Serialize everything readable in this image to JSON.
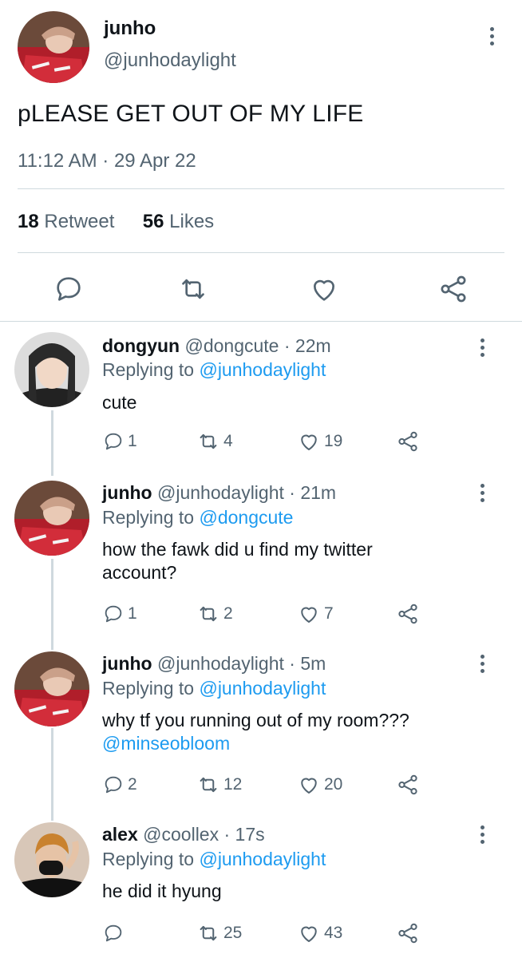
{
  "main_tweet": {
    "name": "junho",
    "handle": "@junhodaylight",
    "text": "pLEASE GET OUT OF MY LIFE",
    "timestamp": "11:12 AM · 29 Apr 22",
    "retweets_count": "18",
    "retweets_label": "Retweet",
    "likes_count": "56",
    "likes_label": "Likes",
    "actions": [
      "reply-icon",
      "retweet-icon",
      "like-icon",
      "share-icon"
    ]
  },
  "replies": [
    {
      "name": "dongyun",
      "handle": "@dongcute",
      "time": "· 22m",
      "replying_prefix": "Replying to",
      "replying_to": "@junhodaylight",
      "text": "cute",
      "mention": "",
      "reply_count": "1",
      "retweet_count": "4",
      "like_count": "19"
    },
    {
      "name": "junho",
      "handle": "@junhodaylight",
      "time": "· 21m",
      "replying_prefix": "Replying to",
      "replying_to": "@dongcute",
      "text_line1": "how the fawk did u find my twitter",
      "text_line2": "account?",
      "reply_count": "1",
      "retweet_count": "2",
      "like_count": "7"
    },
    {
      "name": "junho",
      "handle": "@junhodaylight",
      "time": "· 5m",
      "replying_prefix": "Replying to",
      "replying_to": "@junhodaylight",
      "text": "why tf you running out of my room???",
      "mention": "@minseobloom",
      "reply_count": "2",
      "retweet_count": "12",
      "like_count": "20"
    },
    {
      "name": "alex",
      "handle": "@coollex",
      "time": "· 17s",
      "replying_prefix": "Replying to",
      "replying_to": "@junhodaylight",
      "text": "he did it hyung",
      "reply_count": "",
      "retweet_count": "25",
      "like_count": "43"
    }
  ],
  "colors": {
    "text": "#0f1419",
    "secondary": "#536471",
    "link": "#1d9bf0",
    "divider": "#cfd9de"
  }
}
